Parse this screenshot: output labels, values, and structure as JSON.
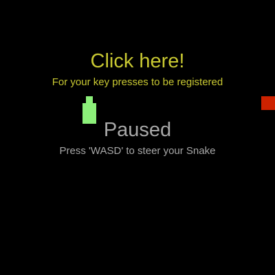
{
  "overlay": {
    "focus_title": "Click here!",
    "focus_subtitle": "For your key presses to be registered",
    "paused_title": "Paused",
    "paused_hint": "Press 'WASD' to steer your Snake"
  },
  "colors": {
    "background": "#000000",
    "focus_text": "#c8c832",
    "paused_text": "#a8a8a8",
    "snake": "#8cf07a",
    "food": "#cc2200"
  },
  "game": {
    "state": "paused",
    "snake_segments": 2
  }
}
